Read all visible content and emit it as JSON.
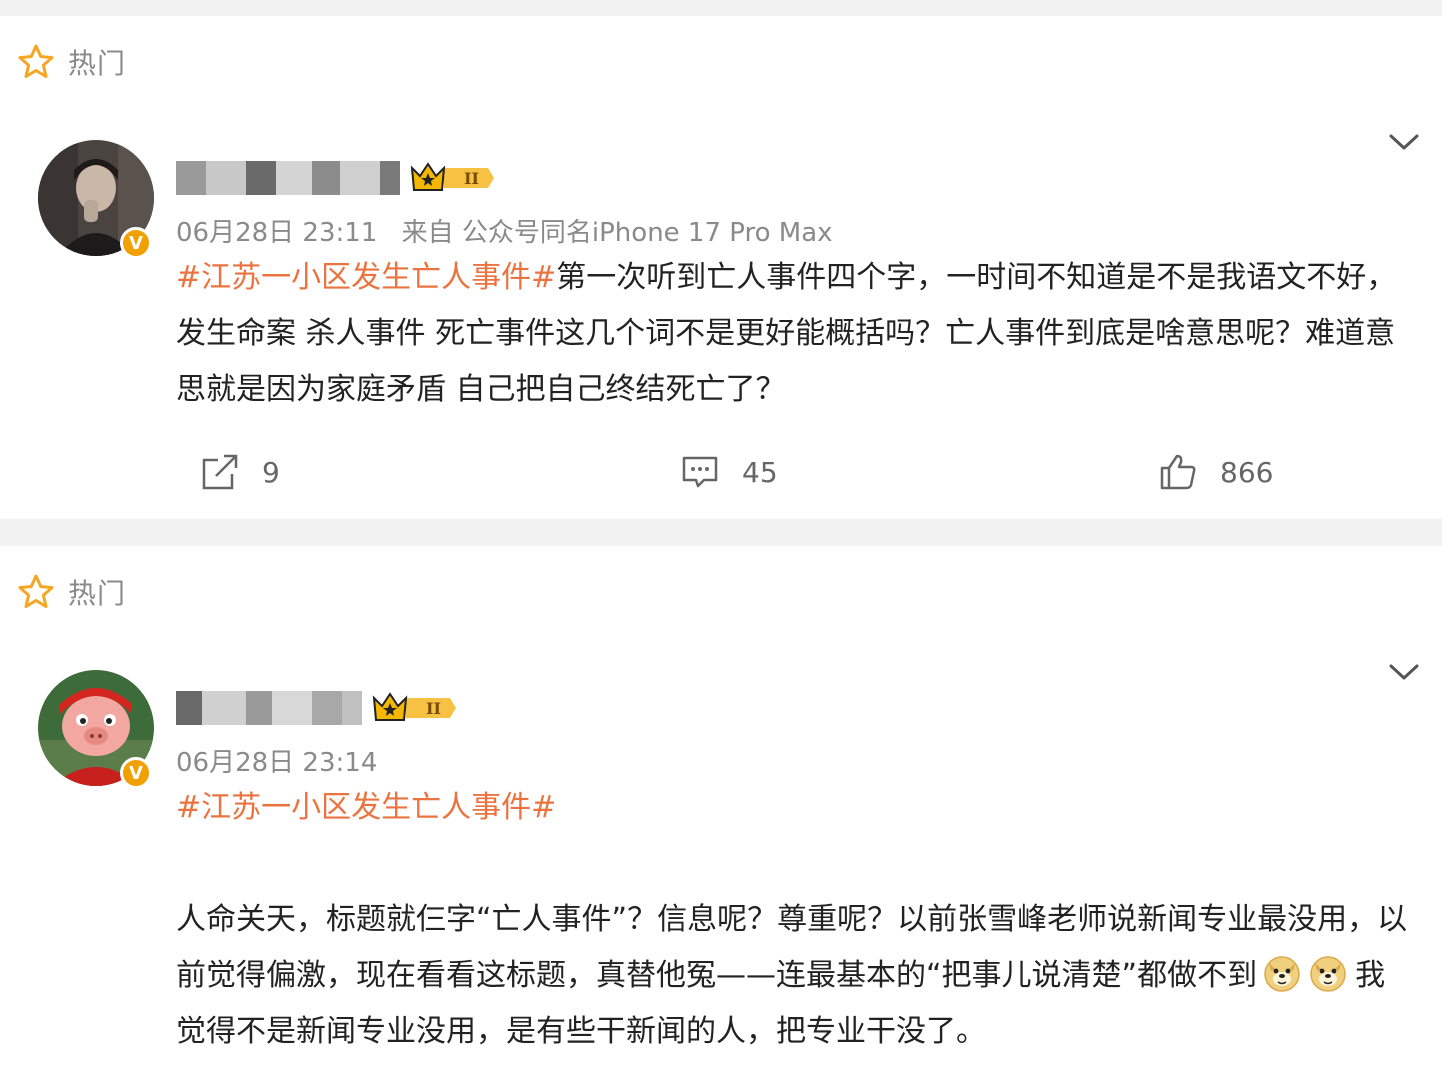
{
  "posts": [
    {
      "section_label": "热门",
      "date": "06月28日 23:11",
      "source": "来自 公众号同名iPhone 17 Pro Max",
      "badge_level": "II",
      "hashtag": "#江苏一小区发生亡人事件#",
      "body": "第一次听到亡人事件四个字，一时间不知道是不是我语文不好，发生命案 杀人事件 死亡事件这几个词不是更好能概括吗？亡人事件到底是啥意思呢？难道意思就是因为家庭矛盾 自己把自己终结死亡了？",
      "repost_count": "9",
      "comment_count": "45",
      "like_count": "866"
    },
    {
      "section_label": "热门",
      "date": "06月28日 23:14",
      "badge_level": "II",
      "hashtag": "#江苏一小区发生亡人事件#",
      "body_line1": "人命关天，标题就仨字“亡人事件”？信息呢？尊重呢？以前张雪峰老师说新闻专业最没用，以前觉得偏激，现在看看这标题，真替他冤——连最基本的“把事儿说清楚”都做不到",
      "body_line2": "我觉得不是新闻专业没用，是有些干新闻的人，把专业干没了。",
      "emojis": [
        "doge-emoji",
        "doge-emoji"
      ]
    }
  ],
  "colors": {
    "hashtag": "#eb7340",
    "meta": "#8a8a8a",
    "text": "#222222",
    "star": "#f5a623",
    "vip_badge": "#f0a000",
    "divider": "#f2f2f2"
  }
}
